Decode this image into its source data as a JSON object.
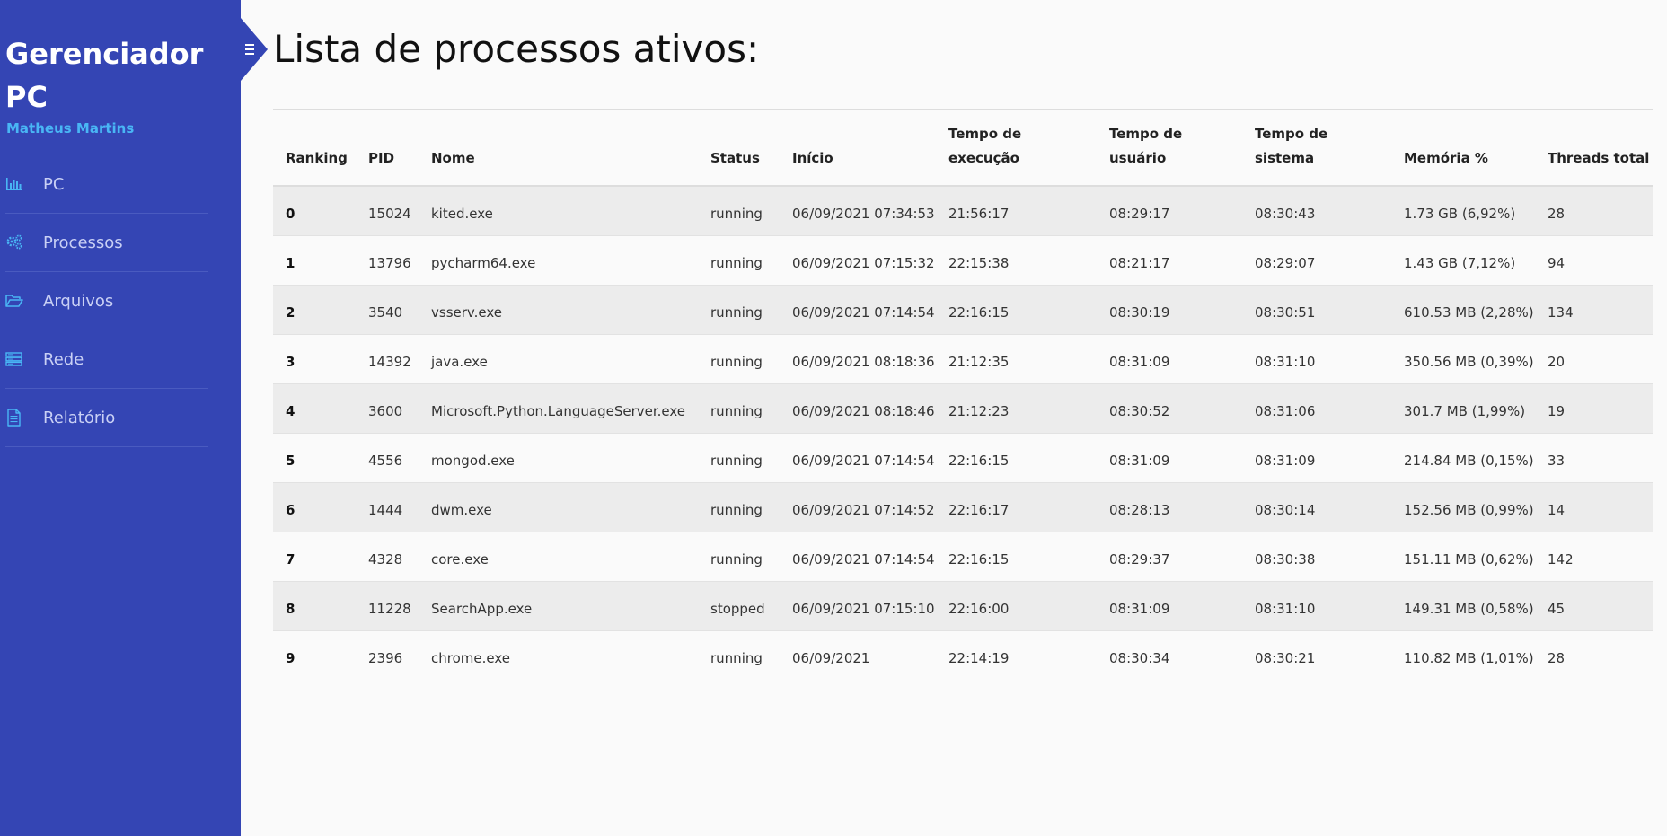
{
  "app": {
    "brand": "Gerenciador PC",
    "author": "Matheus Martins"
  },
  "nav": [
    {
      "label": "PC",
      "icon": "bar-chart-icon"
    },
    {
      "label": "Processos",
      "icon": "gears-icon"
    },
    {
      "label": "Arquivos",
      "icon": "folder-open-icon"
    },
    {
      "label": "Rede",
      "icon": "server-icon"
    },
    {
      "label": "Relatório",
      "icon": "document-icon"
    }
  ],
  "colors": {
    "sidebar": "#3445b4",
    "accent": "#49b6f5"
  },
  "page": {
    "title": "Lista de processos ativos:"
  },
  "table": {
    "headers": {
      "ranking": "Ranking",
      "pid": "PID",
      "nome": "Nome",
      "status": "Status",
      "inicio": "Início",
      "tempo_execucao": "Tempo de execução",
      "tempo_usuario": "Tempo de usuário",
      "tempo_sistema": "Tempo de sistema",
      "memoria": "Memória %",
      "threads": "Threads total"
    },
    "rows": [
      {
        "ranking": "0",
        "pid": "15024",
        "nome": "kited.exe",
        "status": "running",
        "inicio": "06/09/2021 07:34:53",
        "tempo_execucao": "21:56:17",
        "tempo_usuario": "08:29:17",
        "tempo_sistema": "08:30:43",
        "memoria": "1.73 GB (6,92%)",
        "threads": "28"
      },
      {
        "ranking": "1",
        "pid": "13796",
        "nome": "pycharm64.exe",
        "status": "running",
        "inicio": "06/09/2021 07:15:32",
        "tempo_execucao": "22:15:38",
        "tempo_usuario": "08:21:17",
        "tempo_sistema": "08:29:07",
        "memoria": "1.43 GB (7,12%)",
        "threads": "94"
      },
      {
        "ranking": "2",
        "pid": "3540",
        "nome": "vsserv.exe",
        "status": "running",
        "inicio": "06/09/2021 07:14:54",
        "tempo_execucao": "22:16:15",
        "tempo_usuario": "08:30:19",
        "tempo_sistema": "08:30:51",
        "memoria": "610.53 MB (2,28%)",
        "threads": "134"
      },
      {
        "ranking": "3",
        "pid": "14392",
        "nome": "java.exe",
        "status": "running",
        "inicio": "06/09/2021 08:18:36",
        "tempo_execucao": "21:12:35",
        "tempo_usuario": "08:31:09",
        "tempo_sistema": "08:31:10",
        "memoria": "350.56 MB (0,39%)",
        "threads": "20"
      },
      {
        "ranking": "4",
        "pid": "3600",
        "nome": "Microsoft.Python.LanguageServer.exe",
        "status": "running",
        "inicio": "06/09/2021 08:18:46",
        "tempo_execucao": "21:12:23",
        "tempo_usuario": "08:30:52",
        "tempo_sistema": "08:31:06",
        "memoria": "301.7 MB (1,99%)",
        "threads": "19"
      },
      {
        "ranking": "5",
        "pid": "4556",
        "nome": "mongod.exe",
        "status": "running",
        "inicio": "06/09/2021 07:14:54",
        "tempo_execucao": "22:16:15",
        "tempo_usuario": "08:31:09",
        "tempo_sistema": "08:31:09",
        "memoria": "214.84 MB (0,15%)",
        "threads": "33"
      },
      {
        "ranking": "6",
        "pid": "1444",
        "nome": "dwm.exe",
        "status": "running",
        "inicio": "06/09/2021 07:14:52",
        "tempo_execucao": "22:16:17",
        "tempo_usuario": "08:28:13",
        "tempo_sistema": "08:30:14",
        "memoria": "152.56 MB (0,99%)",
        "threads": "14"
      },
      {
        "ranking": "7",
        "pid": "4328",
        "nome": "core.exe",
        "status": "running",
        "inicio": "06/09/2021 07:14:54",
        "tempo_execucao": "22:16:15",
        "tempo_usuario": "08:29:37",
        "tempo_sistema": "08:30:38",
        "memoria": "151.11 MB (0,62%)",
        "threads": "142"
      },
      {
        "ranking": "8",
        "pid": "11228",
        "nome": "SearchApp.exe",
        "status": "stopped",
        "inicio": "06/09/2021 07:15:10",
        "tempo_execucao": "22:16:00",
        "tempo_usuario": "08:31:09",
        "tempo_sistema": "08:31:10",
        "memoria": "149.31 MB (0,58%)",
        "threads": "45"
      },
      {
        "ranking": "9",
        "pid": "2396",
        "nome": "chrome.exe",
        "status": "running",
        "inicio": "06/09/2021",
        "tempo_execucao": "22:14:19",
        "tempo_usuario": "08:30:34",
        "tempo_sistema": "08:30:21",
        "memoria": "110.82 MB (1,01%)",
        "threads": "28"
      }
    ]
  }
}
